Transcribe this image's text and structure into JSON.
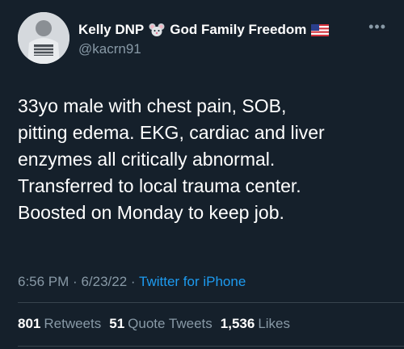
{
  "user": {
    "display_name_prefix": "Kelly DNP",
    "display_name_suffix": "God Family Freedom",
    "handle": "@kacrn91",
    "name_icons": [
      "mouse-face-icon",
      "us-flag-icon"
    ]
  },
  "tweet": {
    "text": "33yo male with chest pain, SOB,\npitting edema. EKG, cardiac and liver\nenzymes all critically abnormal.\nTransferred to local trauma center.\nBoosted on Monday to keep job.",
    "time": "6:56 PM",
    "date": "6/23/22",
    "separator": "·",
    "source": "Twitter for iPhone"
  },
  "stats": {
    "retweets_count": "801",
    "retweets_label": "Retweets",
    "quotes_count": "51",
    "quotes_label": "Quote Tweets",
    "likes_count": "1,536",
    "likes_label": "Likes"
  },
  "more_icon": "more-options-icon",
  "colors": {
    "background": "#15202b",
    "primary_text": "#ffffff",
    "secondary_text": "#8899a6",
    "accent": "#1d9bf0",
    "divider": "#38444d"
  }
}
